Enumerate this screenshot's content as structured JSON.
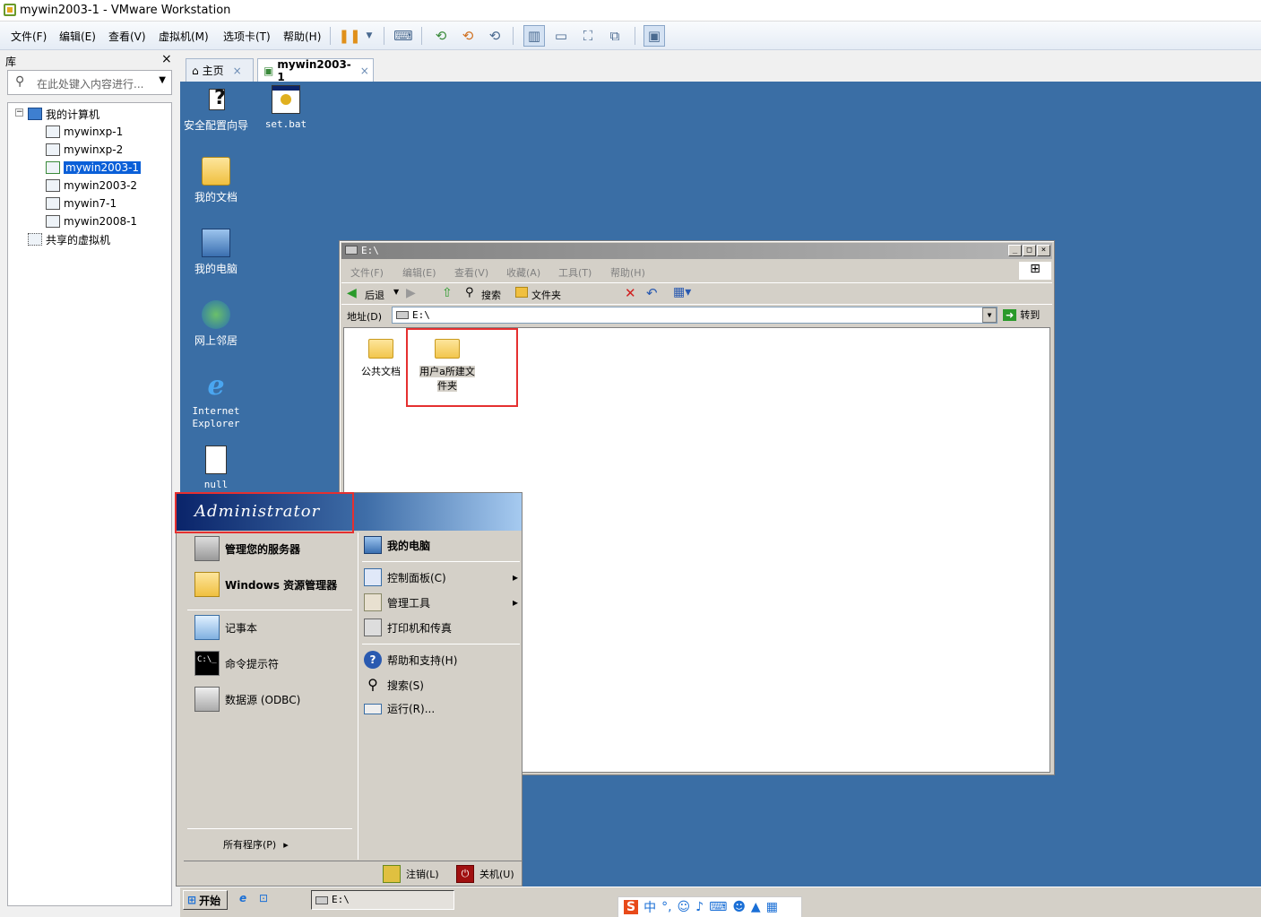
{
  "window": {
    "title": "mywin2003-1 - VMware Workstation"
  },
  "menubar": {
    "items": [
      "文件(F)",
      "编辑(E)",
      "查看(V)",
      "虚拟机(M)",
      "选项卡(T)",
      "帮助(H)"
    ]
  },
  "library": {
    "header": "库",
    "close": "×",
    "search_placeholder": "在此处键入内容进行...",
    "tree": {
      "root": "我的计算机",
      "vms": [
        "mywinxp-1",
        "mywinxp-2",
        "mywin2003-1",
        "mywin2003-2",
        "mywin7-1",
        "mywin2008-1"
      ],
      "selected": "mywin2003-1",
      "shared": "共享的虚拟机"
    }
  },
  "tabs": [
    {
      "label": "主页",
      "close": "×"
    },
    {
      "label": "mywin2003-1",
      "close": "×"
    }
  ],
  "desktop": {
    "icons": [
      "安全配置向导",
      "set.bat",
      "我的文档",
      "我的电脑",
      "网上邻居",
      "Internet Explorer",
      "null"
    ]
  },
  "explorer": {
    "title": "E:\\",
    "menu": [
      "文件(F)",
      "编辑(E)",
      "查看(V)",
      "收藏(A)",
      "工具(T)",
      "帮助(H)"
    ],
    "toolbar": {
      "back": "后退",
      "search": "搜索",
      "folders": "文件夹"
    },
    "address": {
      "label": "地址(D)",
      "value": "E:\\",
      "go": "转到"
    },
    "folders": [
      "公共文档",
      "用户a所建文件夹"
    ]
  },
  "startmenu": {
    "user": "Administrator",
    "left": [
      "管理您的服务器",
      "Windows 资源管理器",
      "记事本",
      "命令提示符",
      "数据源 (ODBC)"
    ],
    "all_programs": "所有程序(P)",
    "right": [
      "我的电脑",
      "控制面板(C)",
      "管理工具",
      "打印机和传真",
      "帮助和支持(H)",
      "搜索(S)",
      "运行(R)..."
    ],
    "logoff": "注销(L)",
    "shutdown": "关机(U)"
  },
  "taskbar": {
    "start": "开始",
    "task": "E:\\",
    "ime": "中"
  }
}
